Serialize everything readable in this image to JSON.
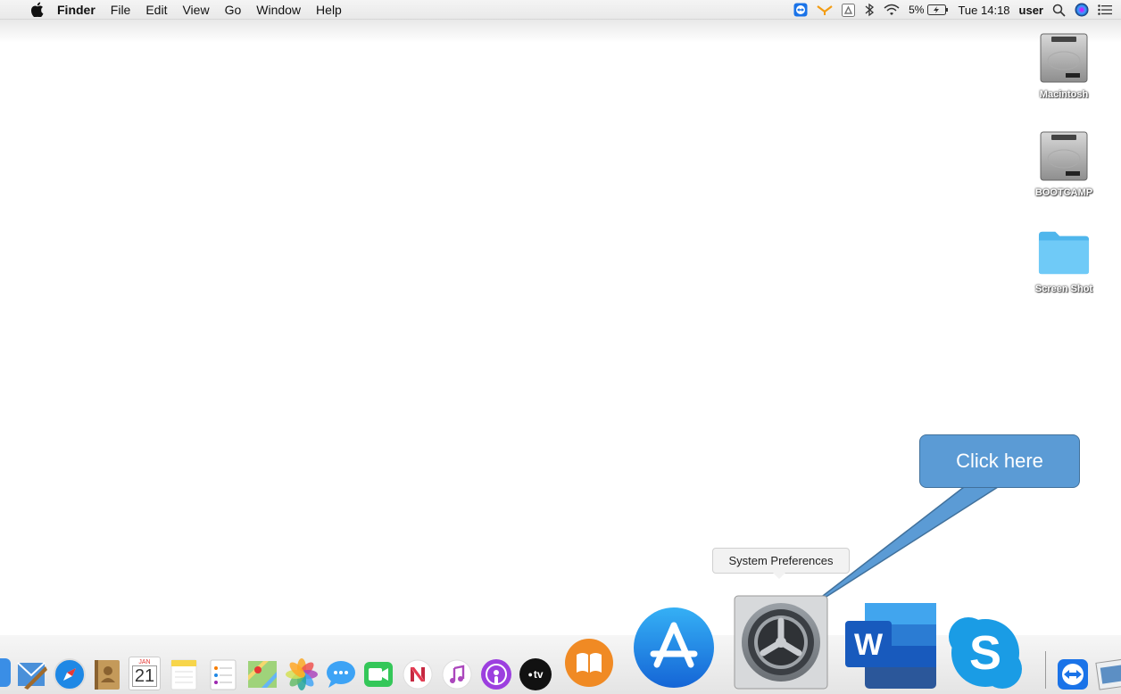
{
  "menubar": {
    "app_name": "Finder",
    "items": [
      "File",
      "Edit",
      "View",
      "Go",
      "Window",
      "Help"
    ],
    "battery": "5%",
    "clock": "Tue 14:18",
    "user": "user"
  },
  "desktop": {
    "icons": [
      {
        "label": "Macintosh",
        "icon": "hard-drive-icon"
      },
      {
        "label": "BOOTCAMP",
        "icon": "hard-drive-icon"
      },
      {
        "label": "Screen Shot",
        "icon": "folder-icon"
      }
    ]
  },
  "callout": {
    "text": "Click here"
  },
  "tooltip": {
    "text": "System Preferences"
  },
  "dock": {
    "apps": [
      "finder",
      "mail",
      "safari",
      "contacts",
      "calendar",
      "notes",
      "reminders",
      "maps",
      "photos",
      "messages",
      "facetime",
      "news",
      "music",
      "podcasts",
      "tv",
      "books",
      "app-store",
      "system-preferences",
      "word",
      "skype",
      "teamviewer",
      "preview"
    ],
    "calendar_month": "JAN",
    "calendar_day": "21",
    "word_letter": "W",
    "skype_letter": "S",
    "tv_label": "tv"
  },
  "colors": {
    "callout": "#5b9bd5",
    "callout_border": "#41719c",
    "folder": "#5ec4f5"
  }
}
